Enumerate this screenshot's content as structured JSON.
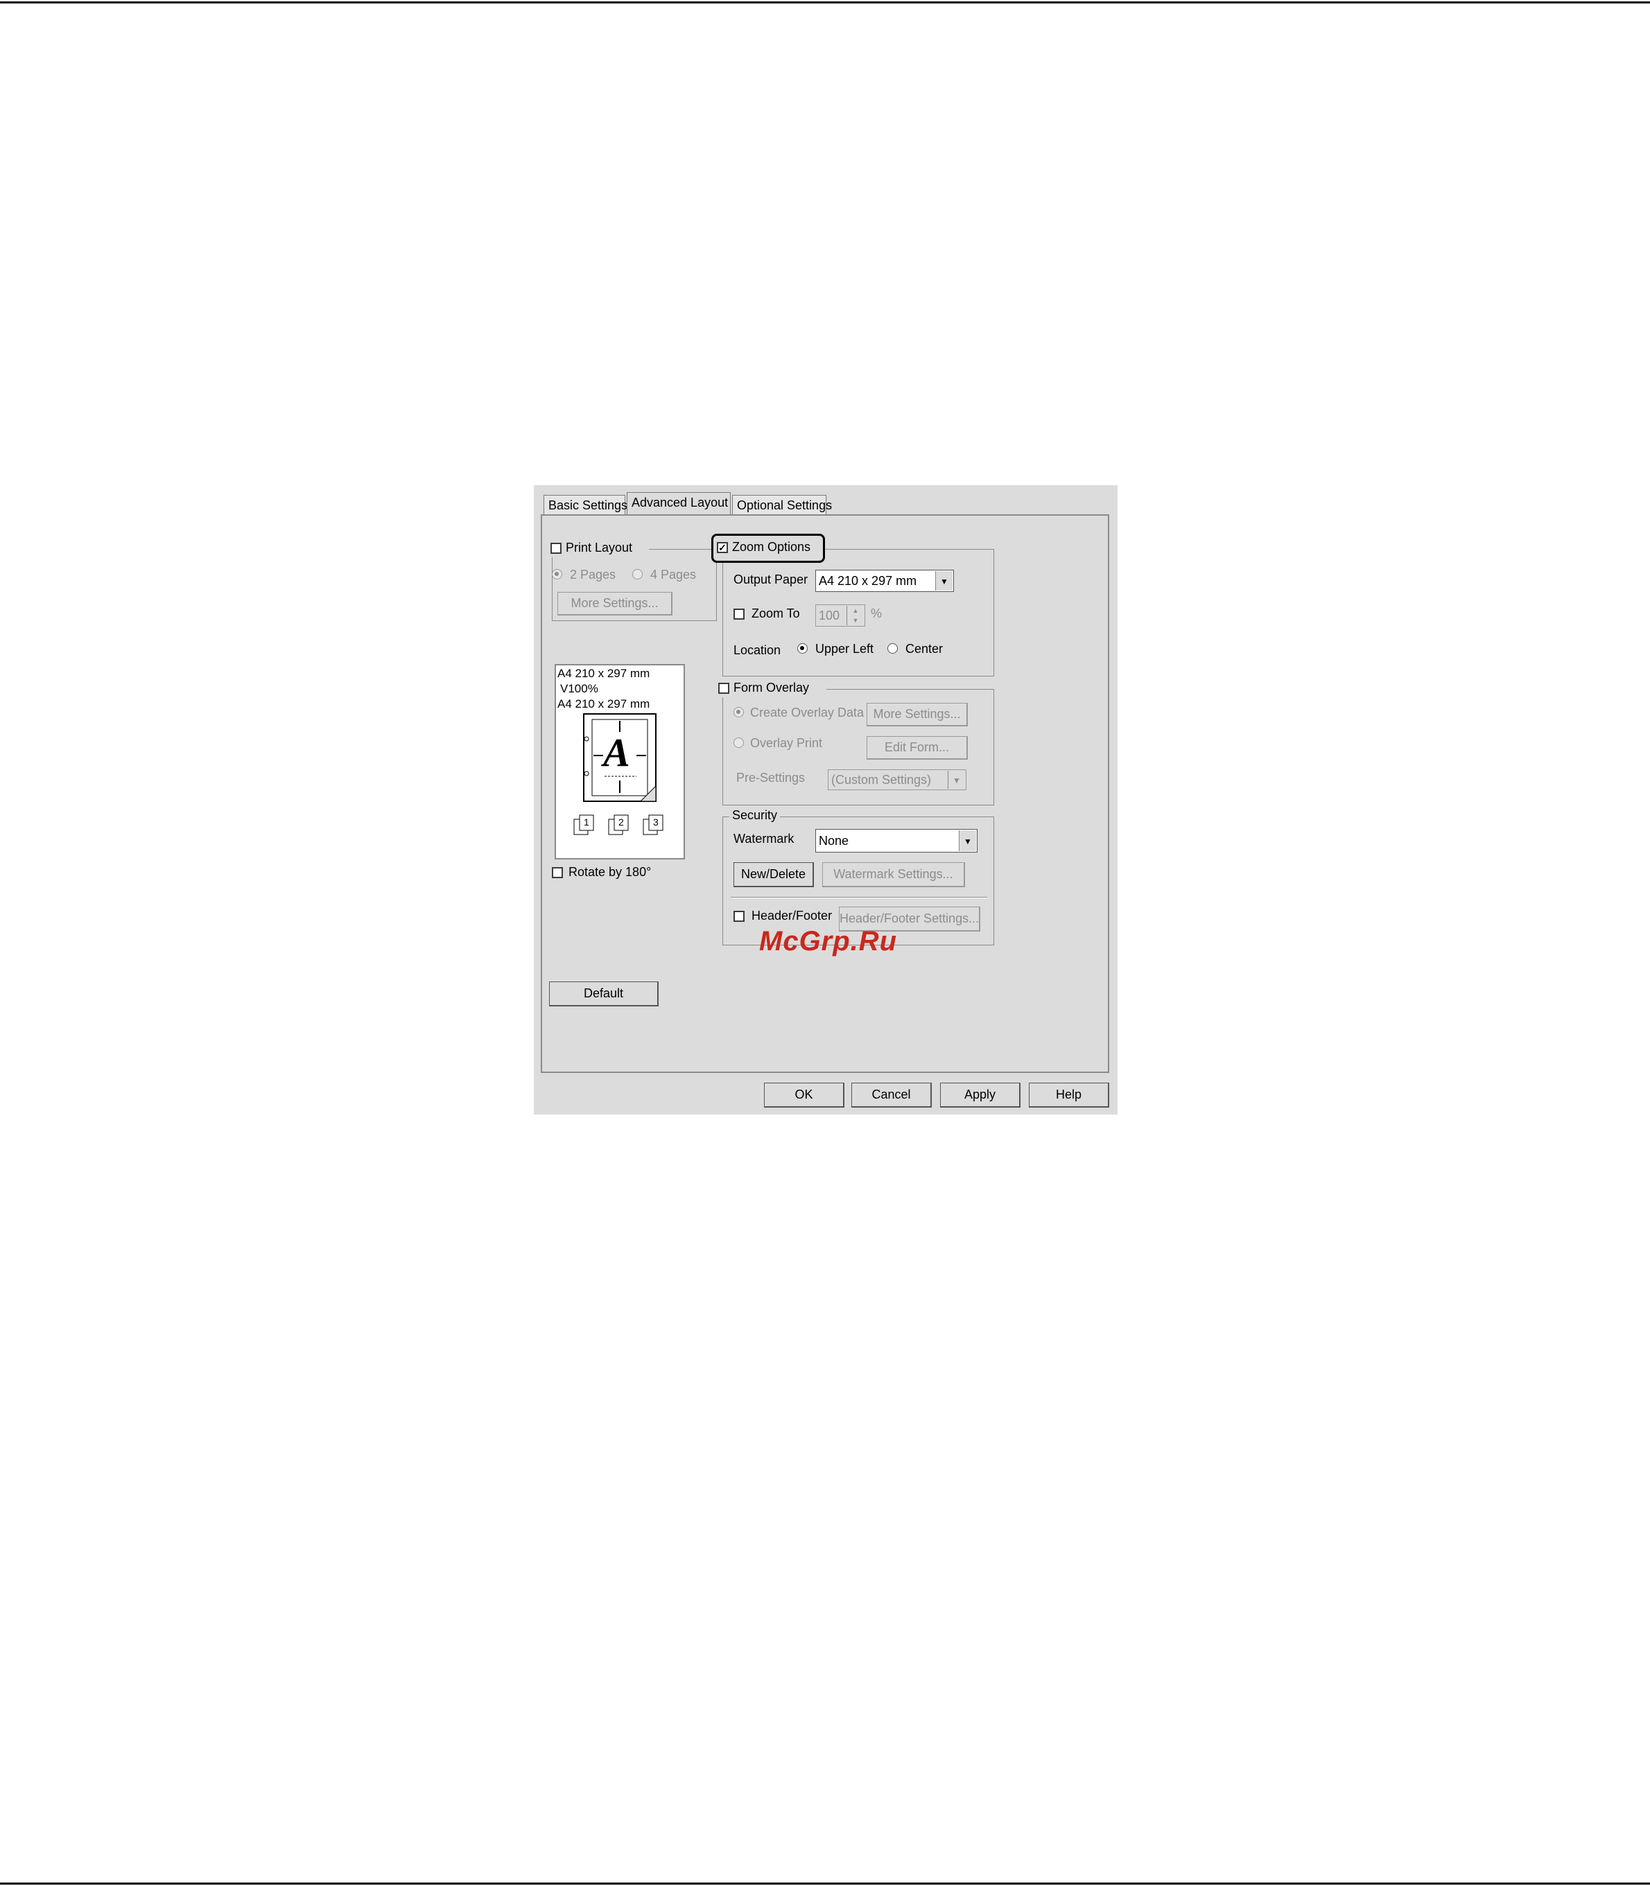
{
  "tabs": [
    "Basic Settings",
    "Advanced Layout",
    "Optional Settings"
  ],
  "active_tab": "Advanced Layout",
  "print_layout": {
    "label": "Print Layout",
    "checked": false,
    "pages2": "2 Pages",
    "pages4": "4 Pages",
    "more_settings": "More Settings..."
  },
  "preview": {
    "line1": "A4 210 x 297 mm",
    "line2": "V100%",
    "line3": "A4 210 x 297 mm",
    "letter": "A",
    "stack_numbers": [
      "1",
      "2",
      "3"
    ]
  },
  "rotate": {
    "label": "Rotate by 180°",
    "checked": false
  },
  "default_button": "Default",
  "zoom_options": {
    "label": "Zoom Options",
    "checked": true,
    "output_paper_label": "Output Paper",
    "output_paper_value": "A4 210 x 297 mm",
    "zoom_to_label": "Zoom To",
    "zoom_to_checked": false,
    "zoom_value": "100",
    "percent": "%",
    "location_label": "Location",
    "upper_left": "Upper Left",
    "center": "Center",
    "location_selected": "Upper Left"
  },
  "form_overlay": {
    "label": "Form Overlay",
    "checked": false,
    "create_overlay": "Create Overlay Data",
    "more_settings": "More Settings...",
    "overlay_print": "Overlay Print",
    "edit_form": "Edit Form...",
    "pre_settings_label": "Pre-Settings",
    "pre_settings_value": "(Custom Settings)"
  },
  "security": {
    "label": "Security",
    "watermark_label": "Watermark",
    "watermark_value": "None",
    "new_delete": "New/Delete",
    "watermark_settings": "Watermark Settings...",
    "header_footer_label": "Header/Footer",
    "header_footer_checked": false,
    "header_footer_settings": "Header/Footer Settings..."
  },
  "buttons": {
    "ok": "OK",
    "cancel": "Cancel",
    "apply": "Apply",
    "help": "Help"
  },
  "site_watermark": "McGrp.Ru",
  "colors": {
    "dialog_bg": "#dcdcdc",
    "watermark_red": "#c8281e"
  }
}
